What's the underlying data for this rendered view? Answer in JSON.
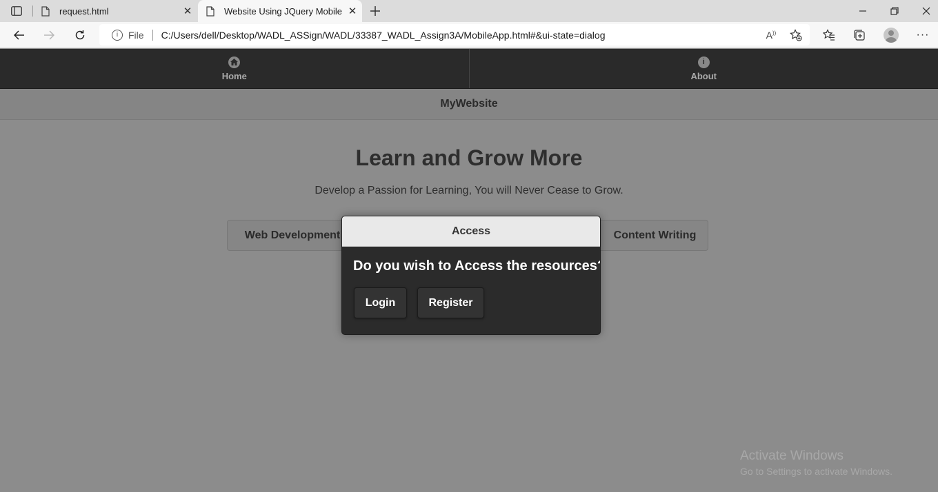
{
  "browser": {
    "tabs": [
      {
        "title": "request.html"
      },
      {
        "title": "Website Using JQuery Mobile"
      }
    ],
    "address": {
      "scheme": "File",
      "url": "C:/Users/dell/Desktop/WADL_ASSign/WADL/33387_WADL_Assign3A/MobileApp.html#&ui-state=dialog"
    }
  },
  "page": {
    "nav": [
      {
        "label": "Home",
        "icon": "home-icon"
      },
      {
        "label": "About",
        "icon": "info-icon"
      }
    ],
    "header_title": "MyWebsite",
    "heading": "Learn and Grow More",
    "subheading": "Develop a Passion for Learning, You will Never Cease to Grow.",
    "buttons": [
      "Web Development",
      "Content Writing"
    ]
  },
  "dialog": {
    "title": "Access",
    "question": "Do you wish to Access the resources?",
    "login_label": "Login",
    "register_label": "Register"
  },
  "watermark": {
    "line1": "Activate Windows",
    "line2": "Go to Settings to activate Windows."
  }
}
